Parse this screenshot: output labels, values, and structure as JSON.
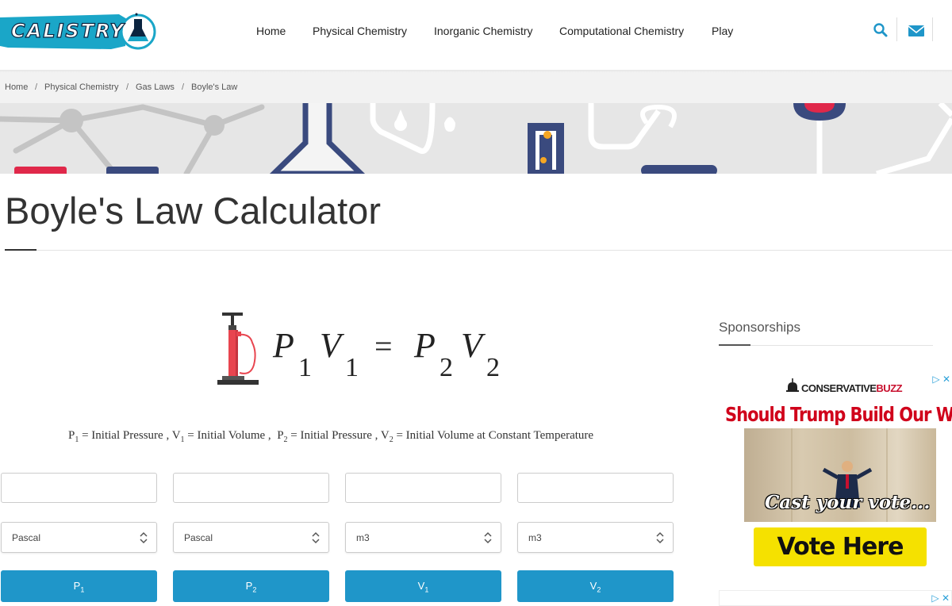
{
  "header": {
    "logo_text": "CALISTRY",
    "nav": [
      "Home",
      "Physical Chemistry",
      "Inorganic Chemistry",
      "Computational Chemistry",
      "Play"
    ],
    "icons": [
      "search-icon",
      "mail-icon"
    ]
  },
  "breadcrumb": [
    "Home",
    "Physical Chemistry",
    "Gas Laws",
    "Boyle's Law"
  ],
  "breadcrumb_separator": "/",
  "page": {
    "title": "Boyle's Law Calculator"
  },
  "formula": {
    "p1": "P",
    "s1": "1",
    "v1": "V",
    "s2": "1",
    "eq": "=",
    "p2": "P",
    "s3": "2",
    "v2": "V",
    "s4": "2"
  },
  "legend": {
    "p1": "P",
    "p1_sub": "1",
    "p1_desc": " = Initial Pressure , ",
    "v1": "V",
    "v1_sub": "1",
    "v1_desc": " = Initial Volume ,  ",
    "p2": "P",
    "p2_sub": "2",
    "p2_desc": " = Initial Pressure , ",
    "v2": "V",
    "v2_sub": "2",
    "v2_desc": " = Initial Volume at Constant Temperature"
  },
  "calculator": {
    "inputs": [
      {
        "value": "",
        "placeholder": ""
      },
      {
        "value": "",
        "placeholder": ""
      },
      {
        "value": "",
        "placeholder": ""
      },
      {
        "value": "",
        "placeholder": ""
      }
    ],
    "units": [
      "Pascal",
      "Pascal",
      "m3",
      "m3"
    ],
    "buttons": [
      {
        "label": "P",
        "sub": "1"
      },
      {
        "label": "P",
        "sub": "2"
      },
      {
        "label": "V",
        "sub": "1"
      },
      {
        "label": "V",
        "sub": "2"
      }
    ]
  },
  "sidebar": {
    "sponsor_title": "Sponsorships",
    "ad": {
      "brand_a": "CONSERVATIVE",
      "brand_b": "BUZZ",
      "headline": "Should Trump Build Our Wall?",
      "tagline": "Cast your vote...",
      "cta": "Vote Here",
      "choices_glyph": "▷ ✕"
    }
  },
  "colors": {
    "accent": "#1f96c9",
    "logo_bg": "#1aa6c8",
    "ad_red": "#d0021b",
    "ad_yellow": "#f5e100"
  }
}
